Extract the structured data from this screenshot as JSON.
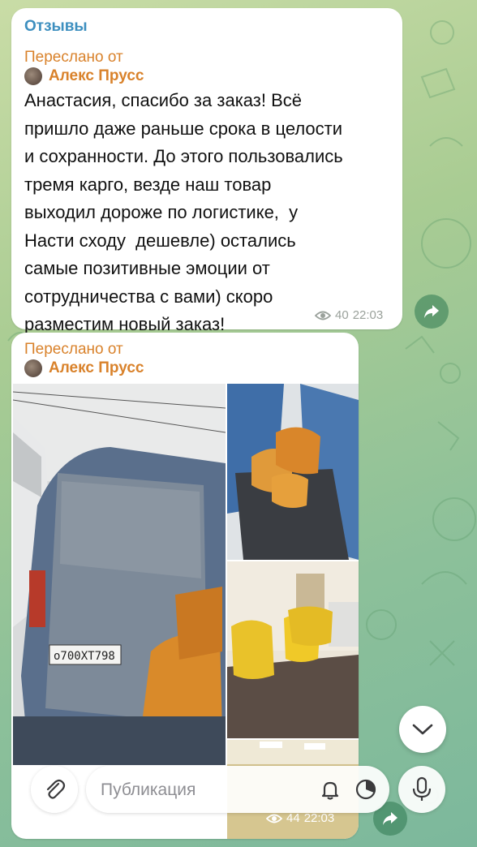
{
  "channel": {
    "name": "Отзывы"
  },
  "posts": [
    {
      "forwarded_label": "Переслано от",
      "forwarded_author": "Алекс Прусс",
      "text": "Анастасия, спасибо за заказ! Всё\nпришло даже раньше срока в целости\nи сохранности. До этого пользовались\nтремя карго, везде наш товар\nвыходил дороже по логистике,  у\nНасти сходу  дешевле) остались\nсамые позитивные эмоции от\nсотрудничества с вами) скоро\nразместим новый заказ!",
      "views": "40",
      "time": "22:03"
    },
    {
      "forwarded_label": "Переслано от",
      "forwarded_author": "Алекс Прусс",
      "photos": [
        {
          "plate_text": "о700ХТ798"
        }
      ],
      "views": "44",
      "time": "22:03"
    }
  ],
  "composer": {
    "placeholder": "Публикация"
  },
  "icons": {
    "views": "eye-icon",
    "share": "share-icon",
    "scroll": "chevron-down-icon",
    "attach": "paperclip-icon",
    "notify": "bell-icon",
    "timer": "timer-icon",
    "mic": "microphone-icon"
  },
  "colors": {
    "channel_name": "#3d8fbf",
    "forward": "#d9822b",
    "meta": "#9aa19b"
  }
}
